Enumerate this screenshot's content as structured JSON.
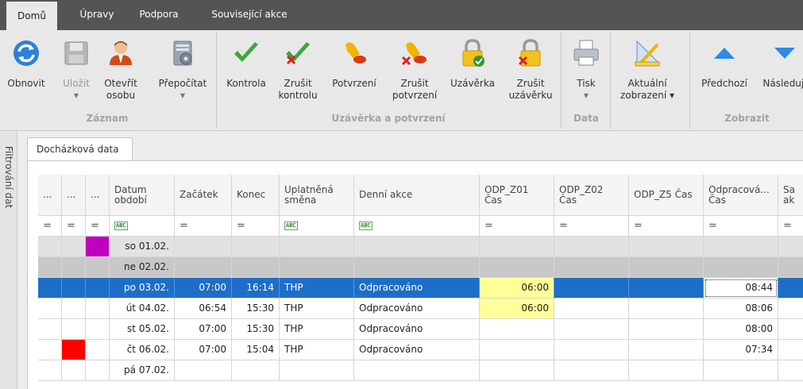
{
  "menu_tabs": [
    "Domů",
    "Úpravy",
    "Podpora",
    "Související akce"
  ],
  "ribbon": {
    "buttons": [
      {
        "name": "refresh",
        "label": "Obnovit",
        "dropdown": false,
        "disabled": false
      },
      {
        "name": "save",
        "label": "Uložit",
        "dropdown": true,
        "disabled": true
      },
      {
        "name": "open-person",
        "label": "Otevřít\nosobu",
        "dropdown": false,
        "disabled": false
      },
      {
        "name": "recalculate",
        "label": "Přepočítat",
        "dropdown": true,
        "disabled": false
      },
      {
        "name": "check",
        "label": "Kontrola",
        "dropdown": false,
        "disabled": false
      },
      {
        "name": "cancel-check",
        "label": "Zrušit\nkontrolu",
        "dropdown": false,
        "disabled": false
      },
      {
        "name": "confirm",
        "label": "Potvrzení",
        "dropdown": false,
        "disabled": false
      },
      {
        "name": "cancel-confirm",
        "label": "Zrušit\npotvrzení",
        "dropdown": false,
        "disabled": false
      },
      {
        "name": "lock",
        "label": "Uzávěrka",
        "dropdown": false,
        "disabled": false
      },
      {
        "name": "cancel-lock",
        "label": "Zrušit\nuzávěrku",
        "dropdown": false,
        "disabled": false
      },
      {
        "name": "print",
        "label": "Tisk",
        "dropdown": true,
        "disabled": false
      },
      {
        "name": "current-view",
        "label": "Aktuální\nzobrazení ▾",
        "dropdown": false,
        "disabled": false
      },
      {
        "name": "previous",
        "label": "Předchozí",
        "dropdown": false,
        "disabled": false
      },
      {
        "name": "next",
        "label": "Následují",
        "dropdown": false,
        "disabled": false
      }
    ],
    "groups": [
      "Záznam",
      "Uzávěrka a potvrzení",
      "Data",
      "Zobrazit"
    ]
  },
  "side_panel_label": "Filtrování dat",
  "doc_tab": "Docházková data",
  "grid": {
    "columns": [
      "...",
      "...",
      "...",
      "Datum\nobdobí",
      "Začátek",
      "Konec",
      "Uplatněná\nsměna",
      "Denní akce",
      "ODP_Z01\nČas",
      "ODP_Z02\nČas",
      "ODP_Z5 Čas",
      "Odpracová...\nČas",
      "Sa\nak"
    ],
    "filter_row": [
      "=",
      "=",
      "=",
      "ABC",
      "=",
      "=",
      "ABC",
      "ABC",
      "=",
      "=",
      "=",
      "=",
      "="
    ],
    "rows": [
      {
        "date": "so 01.02.",
        "start": "",
        "end": "",
        "shift": "",
        "action": "",
        "z01": "",
        "z02": "",
        "z5": "",
        "worked": "",
        "type": "weekend",
        "marker2": "",
        "marker3": "#c000c0"
      },
      {
        "date": "ne 02.02.",
        "start": "",
        "end": "",
        "shift": "",
        "action": "",
        "z01": "",
        "z02": "",
        "z5": "",
        "worked": "",
        "type": "weekend2",
        "marker2": "",
        "marker3": ""
      },
      {
        "date": "po 03.02.",
        "start": "07:00",
        "end": "16:14",
        "shift": "THP",
        "action": "Odpracováno",
        "z01": "06:00",
        "z02": "",
        "z5": "",
        "worked": "08:44",
        "type": "selected",
        "marker2": "",
        "marker3": ""
      },
      {
        "date": "út 04.02.",
        "start": "06:54",
        "end": "15:30",
        "shift": "THP",
        "action": "Odpracováno",
        "z01": "06:00",
        "z02": "",
        "z5": "",
        "worked": "08:06",
        "type": "normal",
        "marker2": "",
        "marker3": ""
      },
      {
        "date": "st 05.02.",
        "start": "07:00",
        "end": "15:30",
        "shift": "THP",
        "action": "Odpracováno",
        "z01": "",
        "z02": "",
        "z5": "",
        "worked": "08:00",
        "type": "normal",
        "marker2": "",
        "marker3": ""
      },
      {
        "date": "čt 06.02.",
        "start": "07:00",
        "end": "15:04",
        "shift": "THP",
        "action": "Odpracováno",
        "z01": "",
        "z02": "",
        "z5": "",
        "worked": "07:34",
        "type": "normal",
        "marker2": "#ff0000",
        "marker3": ""
      },
      {
        "date": "pá 07.02.",
        "start": "",
        "end": "",
        "shift": "",
        "action": "",
        "z01": "",
        "z02": "",
        "z5": "",
        "worked": "",
        "type": "normal",
        "marker2": "",
        "marker3": ""
      }
    ]
  },
  "colors": {
    "selected_row": "#1e6ec8",
    "weekend_row": "#e2e2e2",
    "weekend2_row": "#c8c8c8",
    "highlight_cell": "#ffff99"
  }
}
